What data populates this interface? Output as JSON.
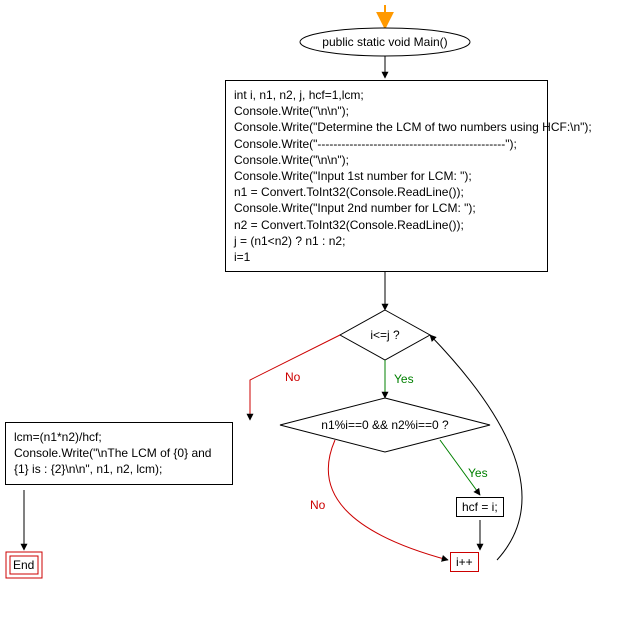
{
  "start_label": "public static void Main()",
  "code_block": "int i, n1, n2, j, hcf=1,lcm;\nConsole.Write(\"\\n\\n\");\nConsole.Write(\"Determine the LCM of two numbers using HCF:\\n\");\nConsole.Write(\"-----------------------------------------------\");\nConsole.Write(\"\\n\\n\");\nConsole.Write(\"Input 1st number for LCM: \");\nn1 = Convert.ToInt32(Console.ReadLine());\nConsole.Write(\"Input 2nd number for LCM: \");\nn2 = Convert.ToInt32(Console.ReadLine());\nj = (n1<n2) ? n1 : n2;\ni=1",
  "decision1": "i<=j ?",
  "decision2": "n1%i==0 && n2%i==0 ?",
  "result_block": "lcm=(n1*n2)/hcf;\nConsole.Write(\"\\nThe LCM of {0} and\n{1} is : {2}\\n\\n\", n1, n2, lcm);",
  "hcf_assign": "hcf = i;",
  "increment": "i++",
  "end_label": "End",
  "yes": "Yes",
  "no": "No"
}
